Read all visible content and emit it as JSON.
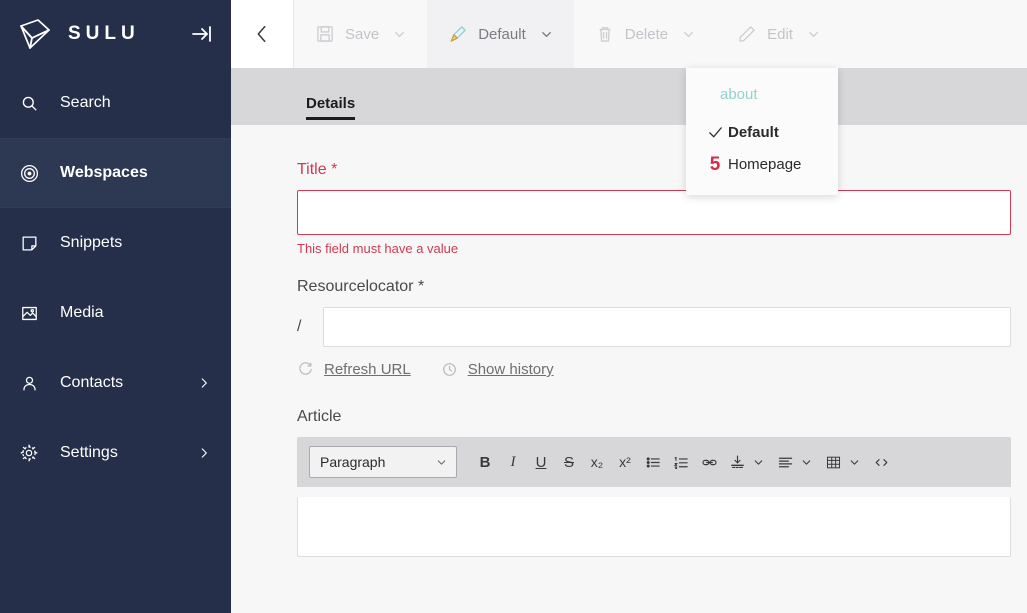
{
  "brand": {
    "name": "SULU",
    "logo_icon": "sulu-logo-icon",
    "collapse_icon": "collapse-sidebar-icon"
  },
  "sidebar": {
    "items": [
      {
        "label": "Search",
        "icon": "search-icon",
        "active": false,
        "has_chevron": false
      },
      {
        "label": "Webspaces",
        "icon": "webspaces-target-icon",
        "active": true,
        "has_chevron": false
      },
      {
        "label": "Snippets",
        "icon": "snippets-page-icon",
        "active": false,
        "has_chevron": false
      },
      {
        "label": "Media",
        "icon": "media-image-icon",
        "active": false,
        "has_chevron": false
      },
      {
        "label": "Contacts",
        "icon": "contacts-person-icon",
        "active": false,
        "has_chevron": true
      },
      {
        "label": "Settings",
        "icon": "settings-gear-icon",
        "active": false,
        "has_chevron": true
      }
    ]
  },
  "toolbar": {
    "back_icon": "back-chevron-icon",
    "buttons": [
      {
        "label": "Save",
        "icon": "save-floppy-icon",
        "caret": true,
        "active": false,
        "disabled": true
      },
      {
        "label": "Default",
        "icon": "brush-template-icon",
        "caret": true,
        "active": true,
        "disabled": false
      },
      {
        "label": "Delete",
        "icon": "delete-trash-icon",
        "caret": true,
        "active": false,
        "disabled": true
      },
      {
        "label": "Edit",
        "icon": "edit-pencil-icon",
        "caret": true,
        "active": false,
        "disabled": true
      }
    ]
  },
  "tabs": [
    {
      "label": "Details",
      "active": true
    }
  ],
  "template_dropdown": {
    "open": true,
    "group_label": "about",
    "group_label_color": "#8fd3cf",
    "items": [
      {
        "label": "Default",
        "selected": true,
        "marker": "check",
        "marker_text": ""
      },
      {
        "label": "Homepage",
        "selected": false,
        "marker": "number",
        "marker_text": "5",
        "marker_color": "#d42c48"
      }
    ]
  },
  "form": {
    "title_field": {
      "label": "Title *",
      "value": "",
      "error": "This field must have a value",
      "has_error": true,
      "error_color": "#cf3a52"
    },
    "resourcelocator_field": {
      "label": "Resourcelocator *",
      "prefix": "/",
      "value": "",
      "actions": [
        {
          "label": "Refresh URL",
          "icon": "refresh-url-icon"
        },
        {
          "label": "Show history",
          "icon": "clock-history-icon"
        }
      ]
    },
    "article_field": {
      "label": "Article",
      "value": "",
      "editor": {
        "block_format": "Paragraph",
        "format_caret_icon": "chevron-down-icon",
        "buttons": [
          {
            "name": "bold-button",
            "glyph": "B",
            "kind": "b"
          },
          {
            "name": "italic-button",
            "glyph": "I",
            "kind": "i"
          },
          {
            "name": "underline-button",
            "glyph": "U",
            "kind": "u"
          },
          {
            "name": "strikethrough-button",
            "glyph": "S",
            "kind": "s"
          },
          {
            "name": "subscript-button",
            "glyph": "x₂",
            "kind": "t"
          },
          {
            "name": "superscript-button",
            "glyph": "x²",
            "kind": "t"
          },
          {
            "name": "bullet-list-button",
            "glyph": "",
            "kind": "svg-ul"
          },
          {
            "name": "numbered-list-button",
            "glyph": "",
            "kind": "svg-ol"
          },
          {
            "name": "link-button",
            "glyph": "",
            "kind": "svg-link"
          },
          {
            "name": "insert-media-button",
            "glyph": "",
            "kind": "svg-media",
            "caret": true
          },
          {
            "name": "align-button",
            "glyph": "",
            "kind": "svg-align",
            "caret": true
          },
          {
            "name": "table-button",
            "glyph": "",
            "kind": "svg-table",
            "caret": true
          },
          {
            "name": "source-code-button",
            "glyph": "",
            "kind": "svg-code"
          }
        ]
      }
    }
  },
  "colors": {
    "sidebar_bg": "#252f49",
    "sidebar_active_bg": "#2d3852",
    "tabbar_bg": "#d7d7d9",
    "content_bg": "#f7f7f8",
    "accent_red": "#cf3a52",
    "accent_teal": "#8fd3cf"
  }
}
